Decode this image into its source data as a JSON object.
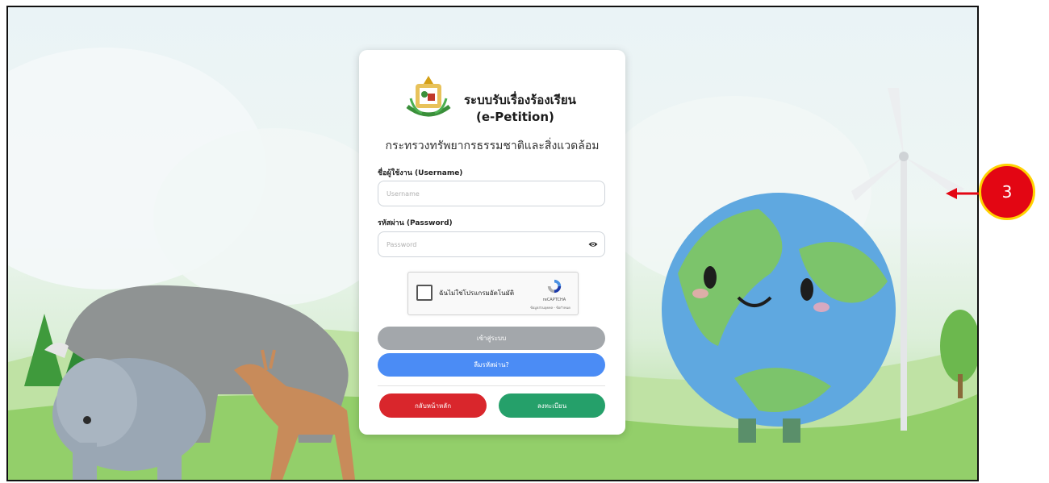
{
  "header": {
    "system_title": "ระบบรับเรื่องร้องเรียน",
    "system_subtitle": "(e-Petition)",
    "ministry": "กระทรวงทรัพยากรธรรมชาติและสิ่งแวดล้อม"
  },
  "form": {
    "username_label": "ชื่อผู้ใช้งาน (Username)",
    "username_placeholder": "Username",
    "username_value": "",
    "password_label": "รหัสผ่าน (Password)",
    "password_placeholder": "Password",
    "password_value": ""
  },
  "captcha": {
    "label": "ฉันไม่ใช่โปรแกรมอัตโนมัติ",
    "brand": "reCAPTCHA",
    "links": "ข้อมูลส่วนบุคคล - ข้อกำหนด",
    "checked": false
  },
  "buttons": {
    "login": "เข้าสู่ระบบ",
    "forgot_password": "ลืมรหัสผ่าน?",
    "back_home": "กลับหน้าหลัก",
    "register": "ลงทะเบียน"
  },
  "annotation": {
    "step_number": "3"
  },
  "colors": {
    "login_button": "#a3a7ab",
    "forgot_button": "#4b8cf5",
    "home_button": "#d9262c",
    "register_button": "#25a06a",
    "badge": "#e30613",
    "badge_border": "#ffd200"
  },
  "icons": {
    "password_toggle": "eye-icon",
    "captcha": "recaptcha-logo-icon",
    "logo": "ministry-emblem"
  }
}
